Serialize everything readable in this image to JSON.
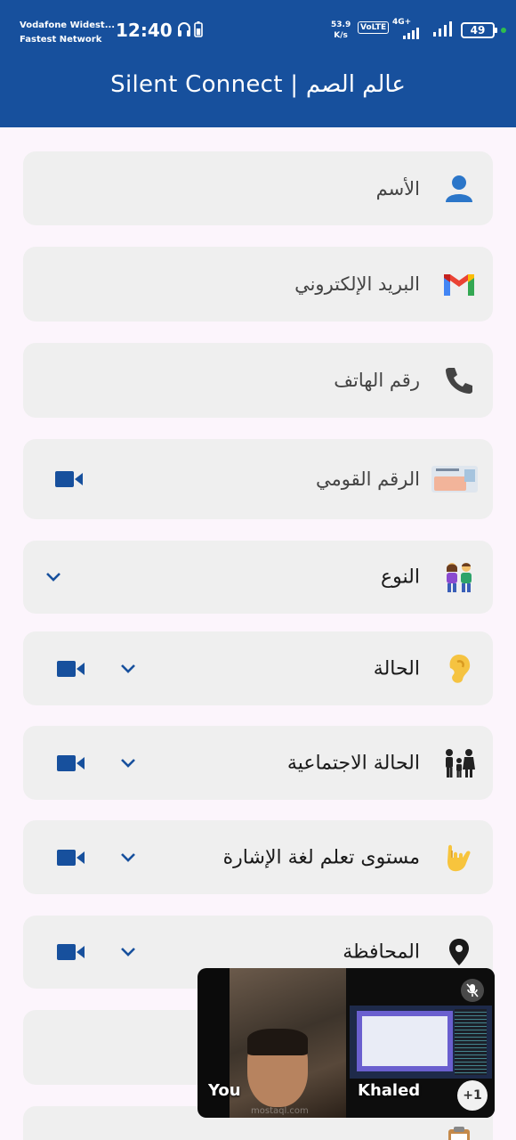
{
  "status_bar": {
    "carrier_line1": "Vodafone Widest...",
    "carrier_line2": "Fastest Network",
    "time": "12:40",
    "net_speed_value": "53.9",
    "net_speed_unit": "K/s",
    "volte": "VoLTE",
    "network_type": "4G+",
    "battery": "49",
    "icons": [
      "headphones-icon",
      "battery-small-icon",
      "signal-icon",
      "signal-icon"
    ]
  },
  "app_bar": {
    "title": "Silent Connect |  عالم الصم"
  },
  "form": {
    "fields": [
      {
        "label": "الأسم",
        "icon": "person-icon"
      },
      {
        "label": "البريد الإلكتروني",
        "icon": "gmail-icon"
      },
      {
        "label": "رقم الهاتف",
        "icon": "phone-icon"
      },
      {
        "label": "الرقم القومي",
        "icon": "id-card-icon",
        "has_video": true
      },
      {
        "label": "النوع",
        "icon": "couple-icon",
        "has_dropdown": true
      },
      {
        "label": "الحالة",
        "icon": "ear-icon",
        "has_dropdown": true,
        "has_video": true
      },
      {
        "label": "الحالة الاجتماعية",
        "icon": "family-icon",
        "has_dropdown": true,
        "has_video": true
      },
      {
        "label": "مستوى تعلم لغة الإشارة",
        "icon": "sign-hand-icon",
        "has_dropdown": true,
        "has_video": true
      },
      {
        "label": "المحافظة",
        "icon": "location-pin-icon",
        "has_dropdown": true,
        "has_video": true
      }
    ]
  },
  "video_call": {
    "self_name": "You",
    "remote_name": "Khaled",
    "more_participants": "+1",
    "watermark": "mostaql.com"
  },
  "colors": {
    "primary": "#17509d",
    "field_bg": "#efefef",
    "page_bg": "#fcf5fc"
  }
}
